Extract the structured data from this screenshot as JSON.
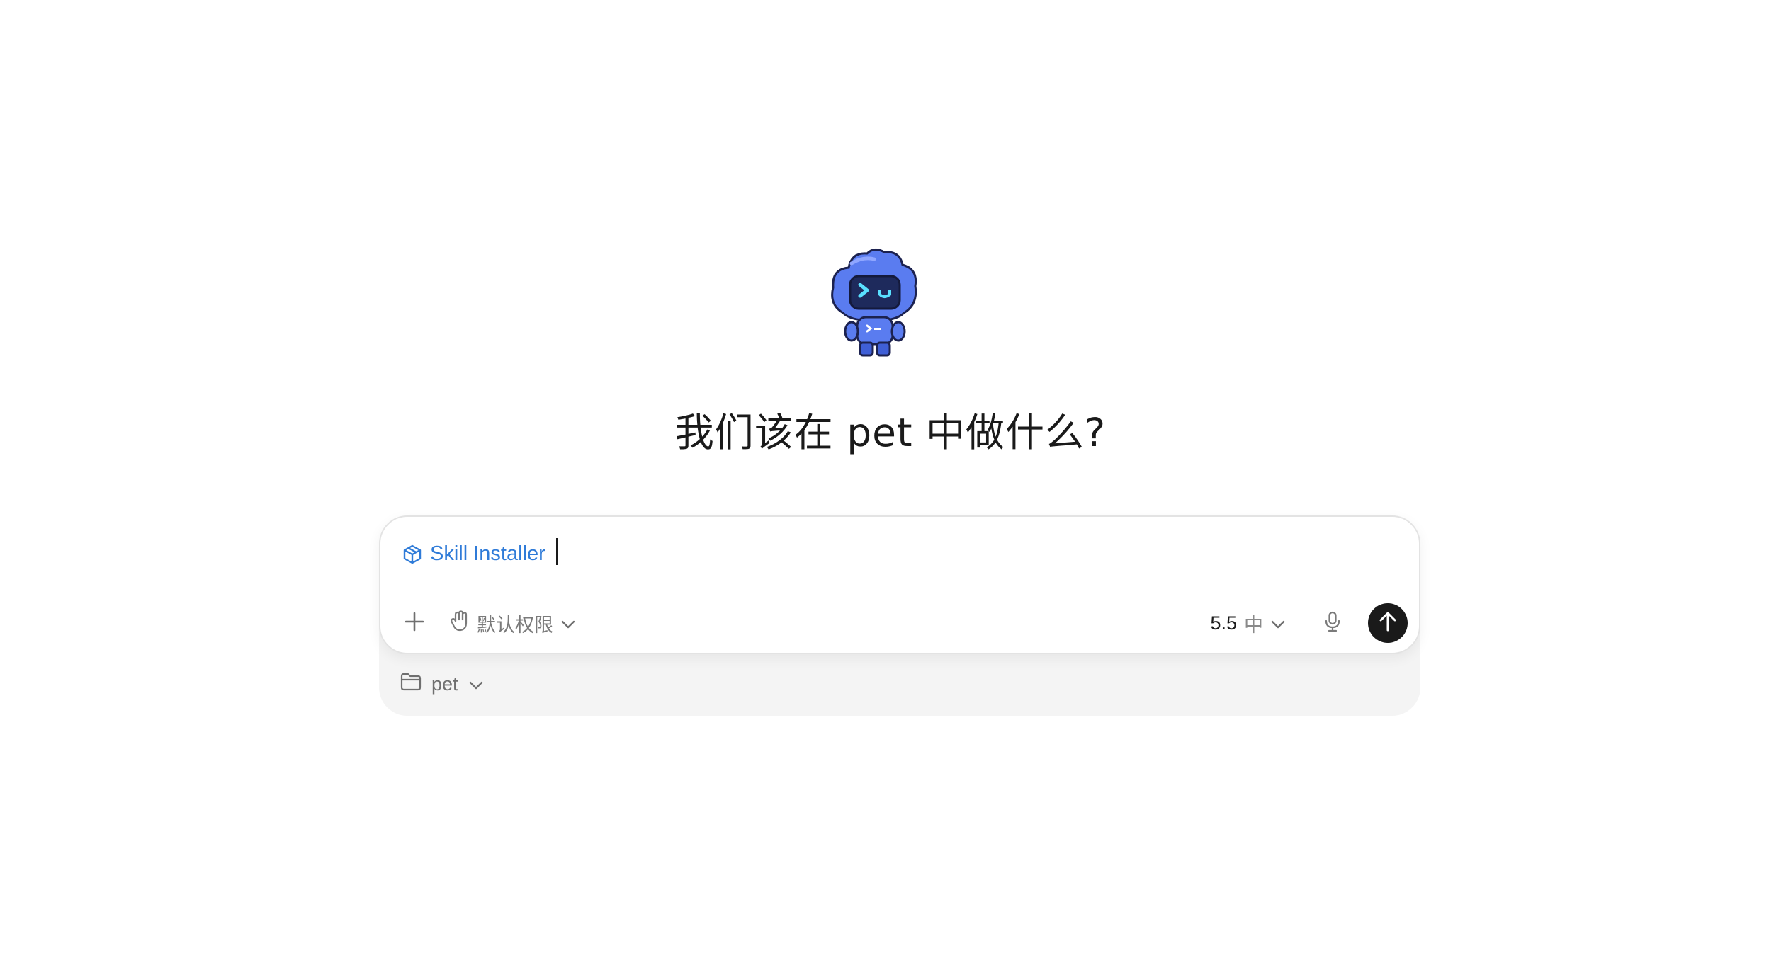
{
  "heading": "我们该在 pet 中做什么?",
  "composer": {
    "skill_label": "Skill Installer",
    "permission_label": "默认权限",
    "model_version": "5.5",
    "model_effort": "中"
  },
  "project": {
    "name": "pet"
  },
  "colors": {
    "accent": "#2f7bd8",
    "send_button": "#1a1a1a",
    "mascot": "#4f72e8"
  },
  "icons": {
    "mascot": "robot-mascot",
    "skill": "cube-icon",
    "add": "plus-icon",
    "permission": "hand-icon",
    "dropdown": "chevron-down-icon",
    "mic": "microphone-icon",
    "send": "arrow-up-icon",
    "folder": "folder-icon"
  }
}
